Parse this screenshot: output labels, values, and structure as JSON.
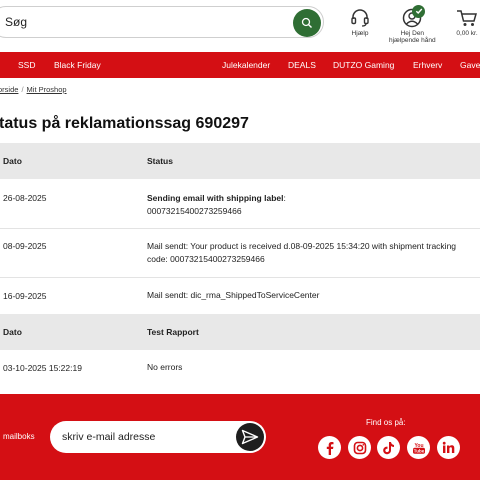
{
  "search": {
    "placeholder": "Søg"
  },
  "header": {
    "help_label": "Hjælp",
    "user_label_line1": "Hej Den",
    "user_label_line2": "hjælpende hånd",
    "cart_label": "0,00 kr."
  },
  "nav": {
    "items": [
      "SSD",
      "Black Friday",
      "Julekalender",
      "DEALS",
      "DUTZO Gaming",
      "Erhverv",
      "Gave"
    ]
  },
  "breadcrumb": {
    "items": [
      "orside",
      "Mit Proshop"
    ]
  },
  "page_title": "tatus på reklamationssag 690297",
  "status_table": {
    "headers": [
      "Dato",
      "Status"
    ],
    "rows": [
      {
        "date": "26-08-2025",
        "status_bold": "Sending email with shipping label",
        "status_suffix": ":",
        "status_line2": "00073215400273259466"
      },
      {
        "date": "08-09-2025",
        "status_line1": "Mail sendt: Your product is received d.08-09-2025 15:34:20 with shipment tracking",
        "status_line2": "code: 00073215400273259466"
      },
      {
        "date": "16-09-2025",
        "status_line1": "Mail sendt: dic_rma_ShippedToServiceCenter"
      }
    ]
  },
  "test_table": {
    "headers": [
      "Dato",
      "Test Rapport"
    ],
    "rows": [
      {
        "date": "03-10-2025 15:22:19",
        "result": "No errors"
      }
    ]
  },
  "footer": {
    "mailbox_label": "mailboks",
    "email_placeholder": "skriv e-mail adresse",
    "find_us_label": "Find os på:",
    "social_icons": [
      "facebook-icon",
      "instagram-icon",
      "tiktok-icon",
      "youtube-icon",
      "linkedin-icon"
    ]
  },
  "colors": {
    "brand_red": "#d40f14",
    "search_green": "#2f6e34",
    "header_gray": "#e8e8e8"
  }
}
